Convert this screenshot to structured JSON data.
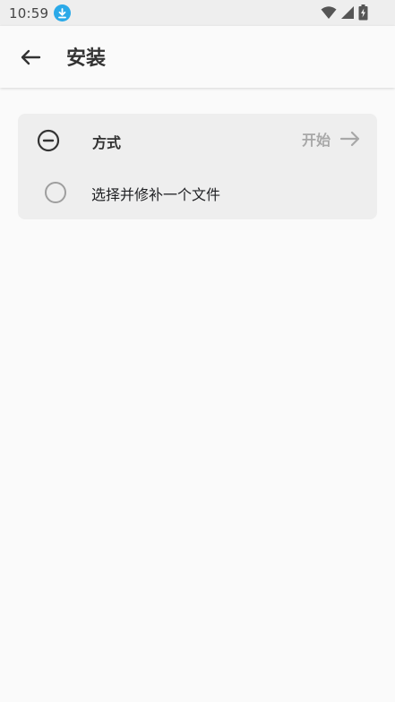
{
  "status_bar": {
    "time": "10:59",
    "icons": [
      "download-icon",
      "wifi-icon",
      "signal-icon",
      "battery-charging-icon"
    ]
  },
  "app_bar": {
    "back_icon": "arrow-left-icon",
    "title": "安装"
  },
  "card": {
    "header_icon": "minus-circle-icon",
    "title": "方式",
    "start_label": "开始",
    "start_icon": "arrow-right-icon",
    "options": [
      {
        "label": "选择并修补一个文件",
        "selected": false
      }
    ]
  },
  "colors": {
    "status_bar_bg": "#eeeeee",
    "background": "#fafafa",
    "card_bg": "#eeeeee",
    "accent_download": "#2aa9e8",
    "disabled_text": "#a8a8a8"
  }
}
